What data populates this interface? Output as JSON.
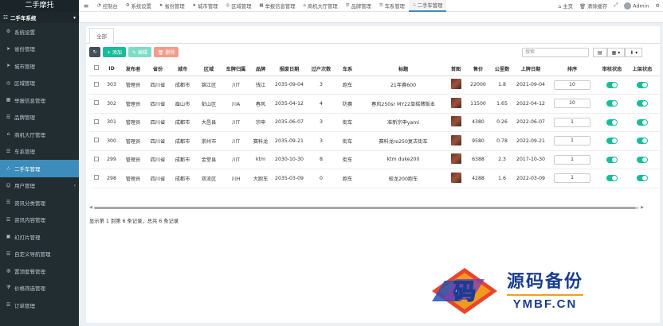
{
  "app": {
    "logo": "二手摩托"
  },
  "sidebar": {
    "section": "二手车系统",
    "items": [
      {
        "label": "系统设置",
        "icon": "gear-icon",
        "has_children": false,
        "active": false
      },
      {
        "label": "省份管理",
        "icon": "send-icon",
        "has_children": false,
        "active": false
      },
      {
        "label": "城市管理",
        "icon": "send-icon",
        "has_children": false,
        "active": false
      },
      {
        "label": "区域管理",
        "icon": "compass-icon",
        "has_children": false,
        "active": false
      },
      {
        "label": "举报信息管理",
        "icon": "calendar-icon",
        "has_children": false,
        "active": false
      },
      {
        "label": "品牌管理",
        "icon": "list-icon",
        "has_children": false,
        "active": false
      },
      {
        "label": "商机大厅管理",
        "icon": "bank-icon",
        "has_children": false,
        "active": false
      },
      {
        "label": "车系管理",
        "icon": "list-icon",
        "has_children": false,
        "active": false
      },
      {
        "label": "二手车管理",
        "icon": "sitemap-icon",
        "has_children": false,
        "active": true
      },
      {
        "label": "用户管理",
        "icon": "user-icon",
        "has_children": true,
        "active": false
      },
      {
        "label": "资讯分类管理",
        "icon": "list-icon",
        "has_children": false,
        "active": false
      },
      {
        "label": "资讯内容管理",
        "icon": "list-icon",
        "has_children": false,
        "active": false
      },
      {
        "label": "幻灯片管理",
        "icon": "image-icon",
        "has_children": false,
        "active": false
      },
      {
        "label": "自定义导航管理",
        "icon": "list-icon",
        "has_children": false,
        "active": false
      },
      {
        "label": "置顶套餐管理",
        "icon": "globe-icon",
        "has_children": false,
        "active": false
      },
      {
        "label": "价格筛选管理",
        "icon": "filter-icon",
        "has_children": false,
        "active": false
      },
      {
        "label": "订单管理",
        "icon": "list-icon",
        "has_children": false,
        "active": false
      }
    ]
  },
  "topbar": {
    "menu_toggle": "≡",
    "tabs": [
      {
        "label": "控制台",
        "icon": "dashboard-icon",
        "active": false
      },
      {
        "label": "系统设置",
        "icon": "gear-icon",
        "active": false
      },
      {
        "label": "省份管理",
        "icon": "send-icon",
        "active": false
      },
      {
        "label": "城市管理",
        "icon": "send-icon",
        "active": false
      },
      {
        "label": "区域管理",
        "icon": "compass-icon",
        "active": false
      },
      {
        "label": "举报信息管理",
        "icon": "calendar-icon",
        "active": false
      },
      {
        "label": "商机大厅管理",
        "icon": "bank-icon",
        "active": false
      },
      {
        "label": "品牌管理",
        "icon": "list-icon",
        "active": false
      },
      {
        "label": "车系管理",
        "icon": "list-icon",
        "active": false
      },
      {
        "label": "二手车管理",
        "icon": "sitemap-icon",
        "active": true
      }
    ],
    "home": "主页",
    "clear_cache": "清除缓存",
    "user": "Admin"
  },
  "main": {
    "tab_all": "全部",
    "buttons": {
      "refresh": "↻",
      "add": "+ 添加",
      "edit": "✎ 编辑",
      "delete": "🗑 删除"
    },
    "search_placeholder": "搜索",
    "columns": [
      "",
      "ID",
      "发布者",
      "省份",
      "城市",
      "区域",
      "车牌归属",
      "品牌",
      "报废日期",
      "过户次数",
      "车系",
      "标题",
      "首图",
      "售价",
      "公里数",
      "上牌日期",
      "排序",
      "审核状态",
      "上架状态",
      "操作"
    ],
    "rows": [
      {
        "id": "303",
        "publisher": "管理员",
        "province": "四川省",
        "city": "成都市",
        "district": "锦江区",
        "plate": "川T",
        "brand": "钱江",
        "scrap_date": "2035-09-04",
        "transfers": "3",
        "series": "跑车",
        "title": "21年赛600",
        "price": "22000",
        "mileage": "1.8",
        "reg_date": "2021-09-04",
        "sort": "10"
      },
      {
        "id": "302",
        "publisher": "管理员",
        "province": "四川省",
        "city": "眉山市",
        "district": "彭山区",
        "plate": "川A",
        "brand": "春风",
        "scrap_date": "2035-04-12",
        "transfers": "4",
        "series": "防赛",
        "title": "春风250sr MY22单摇臂版本",
        "price": "11500",
        "mileage": "1.65",
        "reg_date": "2022-04-12",
        "sort": "10"
      },
      {
        "id": "301",
        "publisher": "管理员",
        "province": "四川省",
        "city": "成都市",
        "district": "大邑县",
        "plate": "川T",
        "brand": "宗申",
        "scrap_date": "2035-06-07",
        "transfers": "3",
        "series": "街车",
        "title": "准新宗申yami",
        "price": "4380",
        "mileage": "0.26",
        "reg_date": "2022-06-07",
        "sort": "1"
      },
      {
        "id": "300",
        "publisher": "管理员",
        "province": "四川省",
        "city": "成都市",
        "district": "崇州市",
        "plate": "川T",
        "brand": "赛科龙",
        "scrap_date": "2035-09-21",
        "transfers": "3",
        "series": "街车",
        "title": "赛科龙re250复古街车",
        "price": "9580",
        "mileage": "0.78",
        "reg_date": "2022-09-21",
        "sort": "1"
      },
      {
        "id": "299",
        "publisher": "管理员",
        "province": "四川省",
        "city": "成都市",
        "district": "金堂县",
        "plate": "川T",
        "brand": "ktm",
        "scrap_date": "2030-10-30",
        "transfers": "8",
        "series": "街车",
        "title": "ktm duke200",
        "price": "6388",
        "mileage": "2.3",
        "reg_date": "2017-10-30",
        "sort": "1"
      },
      {
        "id": "298",
        "publisher": "管理员",
        "province": "四川省",
        "city": "成都市",
        "district": "双流区",
        "plate": "川H",
        "brand": "大跑车",
        "scrap_date": "2035-03-09",
        "transfers": "0",
        "series": "跑车",
        "title": "蛟龙200跑车",
        "price": "4288",
        "mileage": "1.6",
        "reg_date": "2022-03-09",
        "sort": "1"
      }
    ],
    "footer": "显示第 1 到第 6 条记录，总共 6 条记录"
  },
  "watermark": {
    "cn": "源码备份",
    "en": "YMBF.CN",
    "logo_char": "码"
  },
  "colors": {
    "sidebar_bg": "#222d32",
    "active_blue": "#3c8dbc",
    "success": "#18bc9c",
    "danger": "#e74c3c"
  }
}
